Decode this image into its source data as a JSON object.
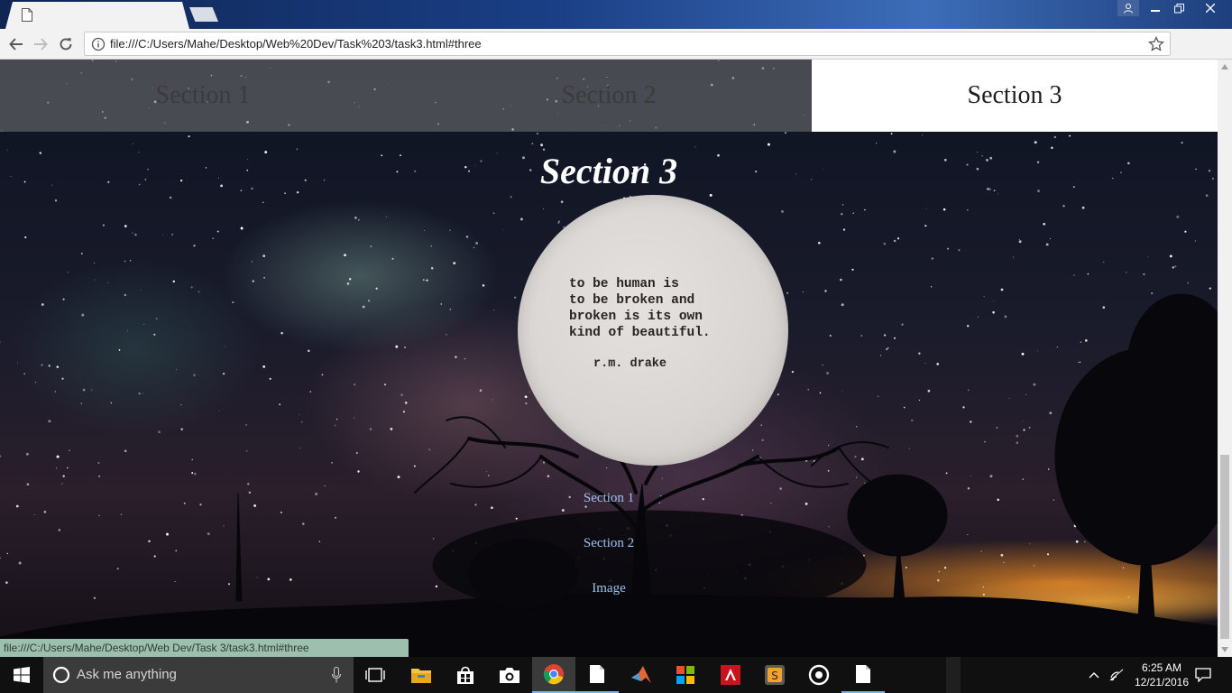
{
  "browser": {
    "url": "file:///C:/Users/Mahe/Desktop/Web%20Dev/Task%203/task3.html#three",
    "status_url": "file:///C:/Users/Mahe/Desktop/Web Dev/Task 3/task3.html#three"
  },
  "page": {
    "nav": {
      "tab1": "Section 1",
      "tab2": "Section 2",
      "tab3": "Section 3",
      "active": "Section 3"
    },
    "heading": "Section 3",
    "quote": {
      "text": "to be human is\nto be broken and\nbroken is its own\nkind of beautiful.",
      "author": "r.m. drake"
    },
    "links": {
      "section1": "Section 1",
      "section2": "Section 2",
      "image": "Image"
    }
  },
  "taskbar": {
    "search_placeholder": "Ask me anything",
    "time": "6:25 AM",
    "date": "12/21/2016"
  }
}
